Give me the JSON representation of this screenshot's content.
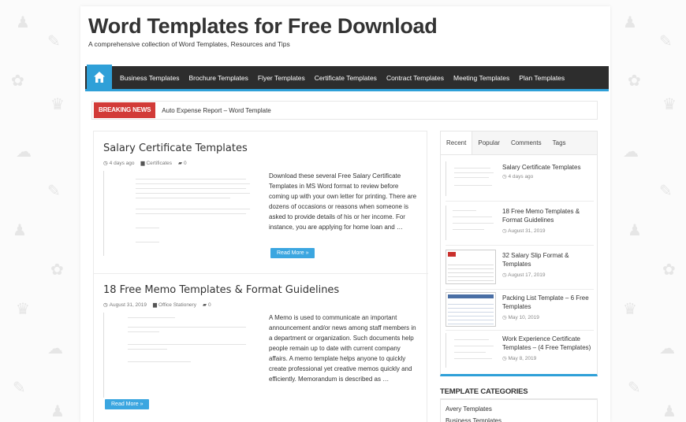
{
  "site": {
    "title": "Word Templates for Free Download",
    "tagline": "A comprehensive collection of Word Templates, Resources and Tips"
  },
  "nav": {
    "home_icon": "home-icon",
    "items": [
      "Business Templates",
      "Brochure Templates",
      "Flyer Templates",
      "Certificate Templates",
      "Contract Templates",
      "Meeting Templates",
      "Plan Templates"
    ]
  },
  "breaking": {
    "label": "BREAKING NEWS",
    "text": "Auto Expense Report – Word Template"
  },
  "posts": [
    {
      "title": "Salary Certificate Templates",
      "date": "4 days ago",
      "category": "Certificates",
      "comments": "0",
      "excerpt": "Download these several Free Salary Certificate Templates in MS Word format to review before coming up with your own letter for printing. There are dozens of occasions or reasons when someone is asked to provide details of his or her income. For instance, you are applying for home loan and …",
      "read_more": "Read More »"
    },
    {
      "title": "18 Free Memo Templates & Format Guidelines",
      "date": "August 31, 2019",
      "category": "Office Stationery",
      "comments": "0",
      "excerpt": "A Memo is used to communicate an important announcement and/or news among staff members in a department or organization. Such documents help people remain up to date with current company affairs. A memo template helps anyone to quickly create professional yet creative memos quickly and efficiently. Memorandum is described as …",
      "read_more": "Read More »"
    }
  ],
  "sidebar": {
    "tabs": [
      "Recent",
      "Popular",
      "Comments",
      "Tags"
    ],
    "items": [
      {
        "title": "Salary Certificate Templates",
        "date": "4 days ago"
      },
      {
        "title": "18 Free Memo Templates & Format Guidelines",
        "date": "August 31, 2019"
      },
      {
        "title": "32 Salary Slip Format & Templates",
        "date": "August 17, 2019"
      },
      {
        "title": "Packing List Template – 6 Free Templates",
        "date": "May 10, 2019"
      },
      {
        "title": "Work Experience Certificate Templates – (4 Free Templates)",
        "date": "May 8, 2019"
      }
    ]
  },
  "categories": {
    "heading": "TEMPLATE CATEGORIES",
    "items": [
      "Avery Templates",
      "Business Templates"
    ]
  },
  "colors": {
    "accent": "#2fa0d8",
    "nav_bg": "#2d2d2d",
    "breaking": "#d23b38",
    "button": "#3ba6e0"
  }
}
